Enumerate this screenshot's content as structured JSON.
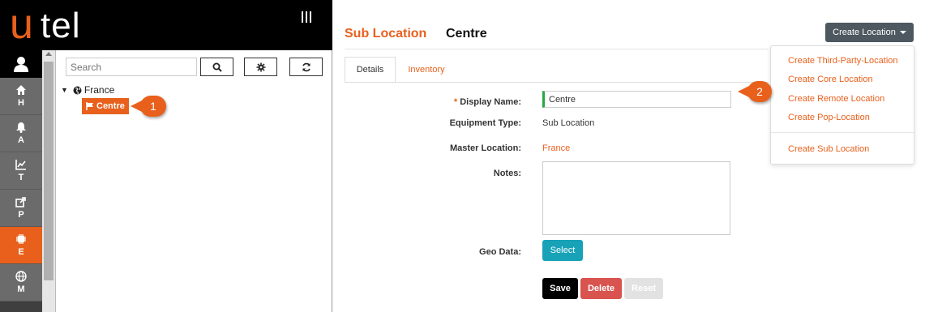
{
  "brand": {
    "logo_u": "u",
    "logo_rest": "tel",
    "accent": "#e8601c"
  },
  "nav": {
    "items": [
      {
        "label": "H",
        "icon": "home-icon"
      },
      {
        "label": "A",
        "icon": "bell-icon"
      },
      {
        "label": "T",
        "icon": "chart-line-icon"
      },
      {
        "label": "P",
        "icon": "share-icon"
      },
      {
        "label": "E",
        "icon": "chip-icon",
        "active": true
      },
      {
        "label": "M",
        "icon": "globe-icon"
      }
    ]
  },
  "tree": {
    "search_placeholder": "Search",
    "root_label": "France",
    "child_label": "Centre"
  },
  "callouts": {
    "one": "1",
    "two": "2"
  },
  "header": {
    "title": "Sub Location",
    "subtitle": "Centre",
    "create_button": "Create Location"
  },
  "tabs": {
    "details": "Details",
    "inventory": "Inventory"
  },
  "form": {
    "display_name_label": "Display Name:",
    "display_name_required": "*",
    "display_name_value": "Centre",
    "equipment_type_label": "Equipment Type:",
    "equipment_type_value": "Sub Location",
    "master_location_label": "Master Location:",
    "master_location_value": "France",
    "notes_label": "Notes:",
    "geo_data_label": "Geo Data:",
    "select_button": "Select",
    "save_button": "Save",
    "delete_button": "Delete",
    "reset_button": "Reset"
  },
  "menu": {
    "items": [
      "Create Third-Party-Location",
      "Create Core Location",
      "Create Remote Location",
      "Create Pop-Location",
      "Create Sub Location"
    ]
  }
}
